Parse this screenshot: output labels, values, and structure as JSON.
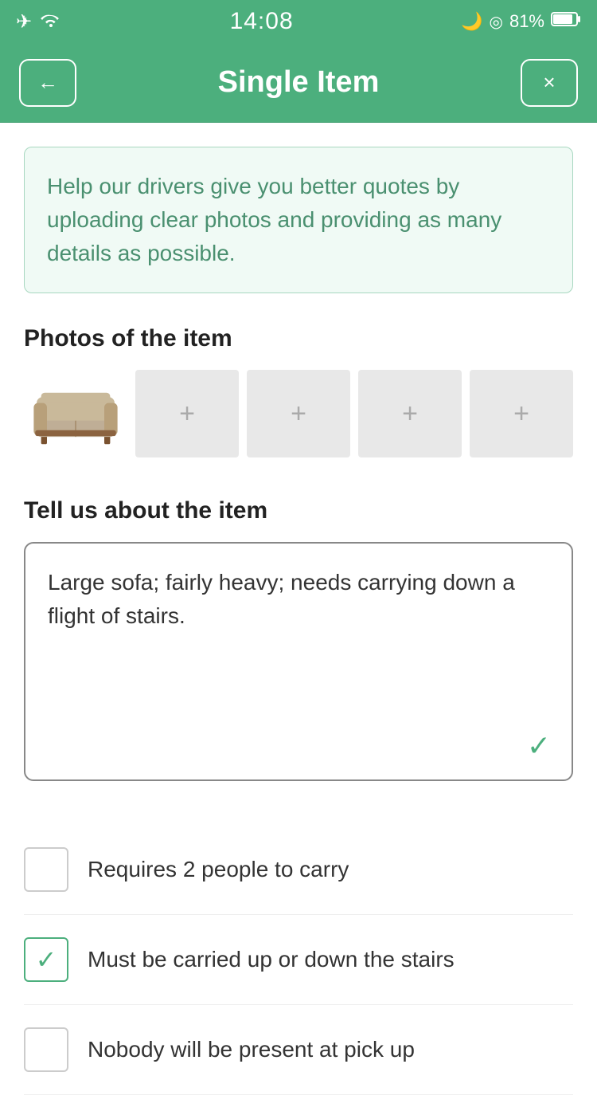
{
  "statusBar": {
    "time": "14:08",
    "battery": "81%"
  },
  "header": {
    "title": "Single Item",
    "backLabel": "←",
    "closeLabel": "×"
  },
  "infoBox": {
    "text": "Help our drivers give you better quotes by uploading clear photos and providing as many details as possible."
  },
  "photos": {
    "sectionTitle": "Photos of the item",
    "addLabel": "+"
  },
  "describe": {
    "sectionTitle": "Tell us about the item",
    "value": "Large sofa; fairly heavy; needs carrying down a flight of stairs."
  },
  "checkboxes": [
    {
      "label": "Requires 2 people to carry",
      "checked": false
    },
    {
      "label": "Must be carried up or down the stairs",
      "checked": true
    },
    {
      "label": "Nobody will be present at pick up",
      "checked": false
    }
  ]
}
